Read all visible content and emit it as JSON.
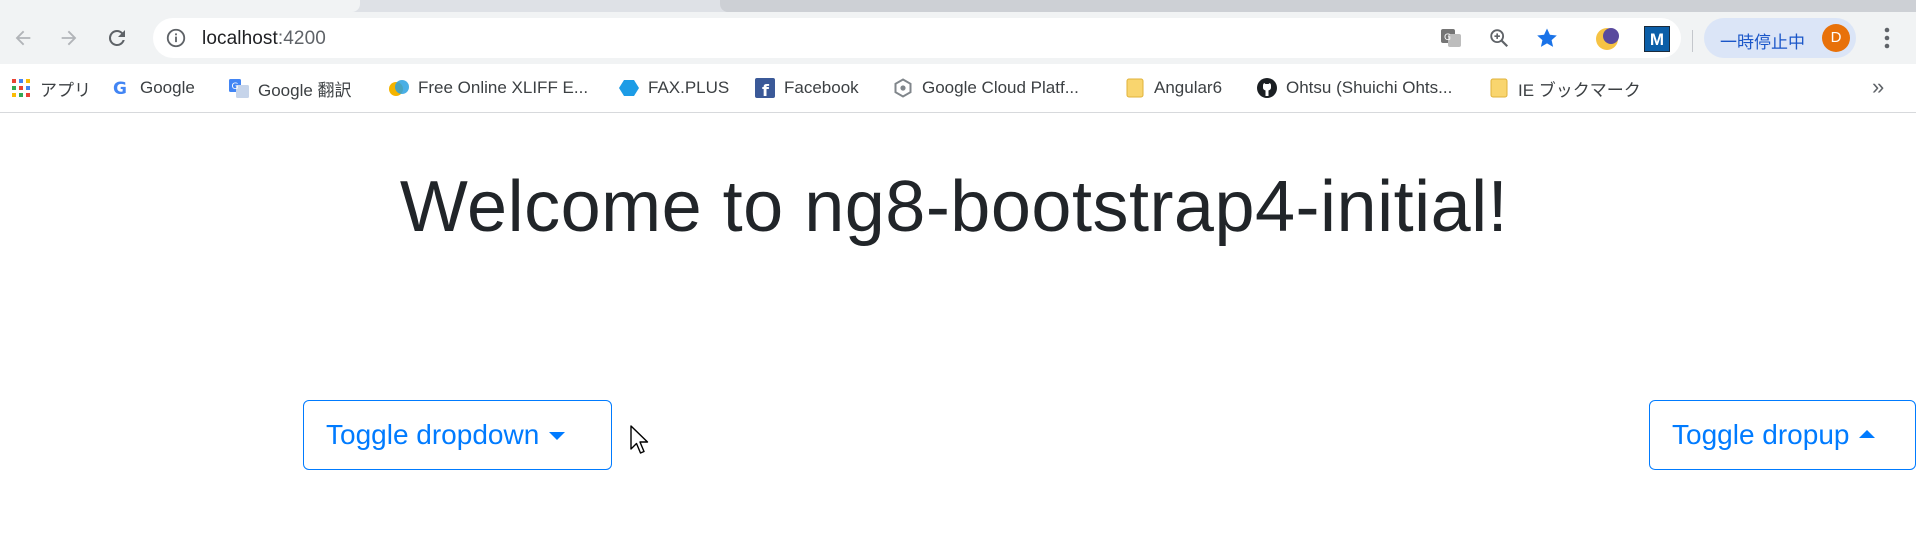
{
  "browser": {
    "url_host": "localhost",
    "url_port": ":4200",
    "pause_label": "一時停止中",
    "profile_initial": "D",
    "extension_m": "M",
    "colors": {
      "toolbar_bg": "#f1f3f4",
      "accent": "#1a73e8",
      "avatar": "#e8710a"
    }
  },
  "bookmarks": [
    {
      "label": "アプリ",
      "icon": "apps-grid-icon"
    },
    {
      "label": "Google",
      "icon": "google-g-icon"
    },
    {
      "label": "Google 翻訳",
      "icon": "google-translate-icon"
    },
    {
      "label": "Free Online XLIFF E...",
      "icon": "xliff-icon"
    },
    {
      "label": "FAX.PLUS",
      "icon": "faxplus-icon"
    },
    {
      "label": "Facebook",
      "icon": "facebook-icon"
    },
    {
      "label": "Google Cloud Platf...",
      "icon": "cloud-icon"
    },
    {
      "label": "Angular6",
      "icon": "folder-icon"
    },
    {
      "label": "Ohtsu (Shuichi Ohts...",
      "icon": "github-icon"
    },
    {
      "label": "IE ブックマーク",
      "icon": "folder-icon"
    }
  ],
  "bookmarks_overflow": "»",
  "page": {
    "heading": "Welcome to ng8-bootstrap4-initial!",
    "dropdown_button": "Toggle dropdown",
    "dropup_button": "Toggle dropup",
    "primary_color": "#007bff"
  }
}
